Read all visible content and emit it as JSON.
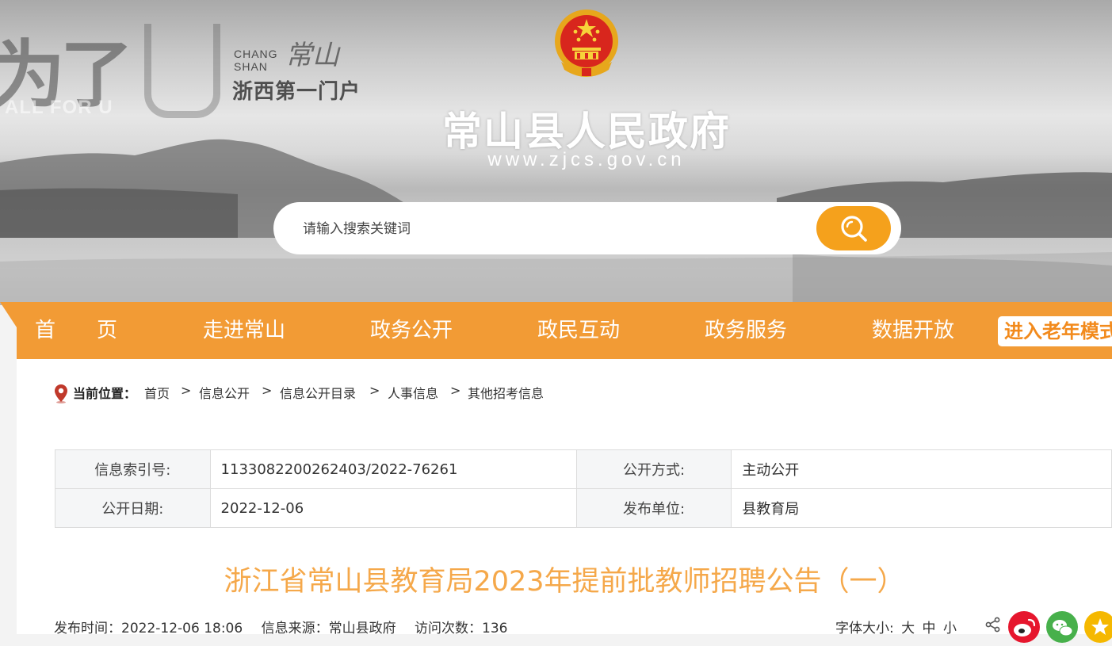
{
  "banner": {
    "slogan_big": "为了",
    "slogan_sub": "ALL FOR U",
    "chang": "CHANG",
    "shan": "SHAN",
    "calligraphy": "常山",
    "portal": "浙西第一门户",
    "site_title": "常山县人民政府",
    "site_url": "www.zjcs.gov.cn"
  },
  "search": {
    "placeholder": "请输入搜索关键词",
    "button_icon": "search-icon"
  },
  "nav": {
    "items": [
      "首　　页",
      "走进常山",
      "政务公开",
      "政民互动",
      "政务服务",
      "数据开放"
    ],
    "elder_mode": "进入老年模式"
  },
  "breadcrumb": {
    "label": "当前位置：",
    "items": [
      "首页",
      "信息公开",
      "信息公开目录",
      "人事信息",
      "其他招考信息"
    ],
    "separator": ">"
  },
  "meta": {
    "index_no_label": "信息索引号:",
    "index_no": "113308220026240​3/2022-76261",
    "open_mode_label": "公开方式:",
    "open_mode": "主动公开",
    "open_date_label": "公开日期:",
    "open_date": "2022-12-06",
    "publisher_label": "发布单位:",
    "publisher": "县教育局"
  },
  "article": {
    "title": "浙江省常山县教育局2023年提前批教师招聘公告（一）",
    "publish_time": "发布时间：2022-12-06 18:06",
    "source": "信息来源：常山县政府",
    "visits": "访问次数：136",
    "font_size_label": "字体大小:",
    "font_large": "大",
    "font_medium": "中",
    "font_small": "小"
  },
  "share": {
    "icons": [
      "share-icon",
      "weibo-icon",
      "wechat-icon",
      "favorite-icon"
    ]
  }
}
